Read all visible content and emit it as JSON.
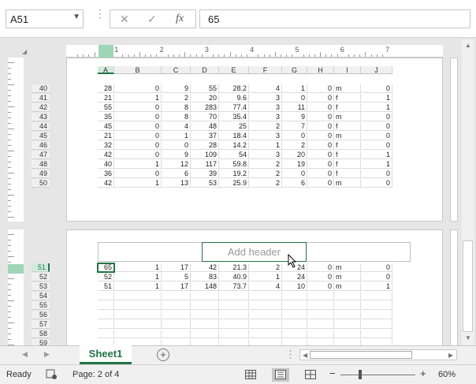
{
  "formula_bar": {
    "name_box": "A51",
    "cancel_glyph": "✕",
    "enter_glyph": "✓",
    "fx_label": "fx",
    "formula_value": "65"
  },
  "ruler": {
    "marks": [
      "1",
      "2",
      "3",
      "4",
      "5",
      "6",
      "7"
    ]
  },
  "columns": [
    "A",
    "B",
    "C",
    "D",
    "E",
    "F",
    "G",
    "H",
    "I",
    "J"
  ],
  "page1_rows": [
    {
      "row": "40",
      "cells": [
        "28",
        "0",
        "9",
        "55",
        "28.2",
        "4",
        "1",
        "0",
        "m",
        "0"
      ]
    },
    {
      "row": "41",
      "cells": [
        "21",
        "1",
        "2",
        "20",
        "9.6",
        "3",
        "0",
        "0",
        "f",
        "1"
      ]
    },
    {
      "row": "42",
      "cells": [
        "55",
        "0",
        "8",
        "283",
        "77.4",
        "3",
        "11",
        "0",
        "f",
        "1"
      ]
    },
    {
      "row": "43",
      "cells": [
        "35",
        "0",
        "8",
        "70",
        "35.4",
        "3",
        "9",
        "0",
        "m",
        "0"
      ]
    },
    {
      "row": "44",
      "cells": [
        "45",
        "0",
        "4",
        "48",
        "25",
        "2",
        "7",
        "0",
        "f",
        "0"
      ]
    },
    {
      "row": "45",
      "cells": [
        "21",
        "0",
        "1",
        "37",
        "18.4",
        "3",
        "0",
        "0",
        "m",
        "0"
      ]
    },
    {
      "row": "46",
      "cells": [
        "32",
        "0",
        "0",
        "28",
        "14.2",
        "1",
        "2",
        "0",
        "f",
        "0"
      ]
    },
    {
      "row": "47",
      "cells": [
        "42",
        "0",
        "9",
        "109",
        "54",
        "3",
        "20",
        "0",
        "f",
        "1"
      ]
    },
    {
      "row": "48",
      "cells": [
        "40",
        "1",
        "12",
        "117",
        "59.8",
        "2",
        "19",
        "0",
        "f",
        "1"
      ]
    },
    {
      "row": "49",
      "cells": [
        "36",
        "0",
        "6",
        "39",
        "19.2",
        "2",
        "0",
        "0",
        "f",
        "0"
      ]
    },
    {
      "row": "50",
      "cells": [
        "42",
        "1",
        "13",
        "53",
        "25.9",
        "2",
        "6",
        "0",
        "m",
        "0"
      ]
    }
  ],
  "page2_rows": [
    {
      "row": "51",
      "cells": [
        "65",
        "1",
        "17",
        "42",
        "21.3",
        "2",
        "24",
        "0",
        "m",
        "0"
      ]
    },
    {
      "row": "52",
      "cells": [
        "52",
        "1",
        "5",
        "83",
        "40.9",
        "1",
        "24",
        "0",
        "m",
        "0"
      ]
    },
    {
      "row": "53",
      "cells": [
        "51",
        "1",
        "17",
        "148",
        "73.7",
        "4",
        "10",
        "0",
        "m",
        "1"
      ]
    },
    {
      "row": "54",
      "cells": [
        "",
        "",
        "",
        "",
        "",
        "",
        "",
        "",
        "",
        ""
      ]
    },
    {
      "row": "55",
      "cells": [
        "",
        "",
        "",
        "",
        "",
        "",
        "",
        "",
        "",
        ""
      ]
    },
    {
      "row": "56",
      "cells": [
        "",
        "",
        "",
        "",
        "",
        "",
        "",
        "",
        "",
        ""
      ]
    },
    {
      "row": "57",
      "cells": [
        "",
        "",
        "",
        "",
        "",
        "",
        "",
        "",
        "",
        ""
      ]
    },
    {
      "row": "58",
      "cells": [
        "",
        "",
        "",
        "",
        "",
        "",
        "",
        "",
        "",
        ""
      ]
    },
    {
      "row": "59",
      "cells": [
        "",
        "",
        "",
        "",
        "",
        "",
        "",
        "",
        "",
        ""
      ]
    }
  ],
  "add_header_text": "Add header",
  "sheet_tabs": {
    "active": "Sheet1",
    "add_glyph": "+"
  },
  "status_bar": {
    "ready": "Ready",
    "page_info": "Page: 2 of 4",
    "zoom": "60%",
    "zoom_minus": "−",
    "zoom_plus": "+"
  }
}
